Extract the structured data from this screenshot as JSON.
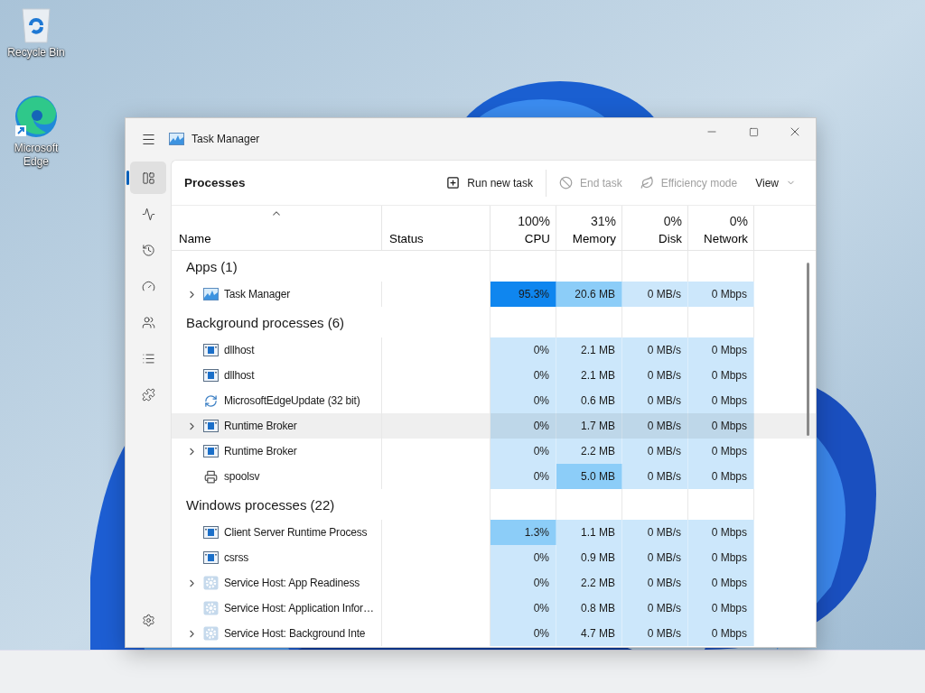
{
  "desktop": {
    "icons": [
      {
        "label": "Recycle Bin",
        "kind": "recycle"
      },
      {
        "label": "Microsoft Edge",
        "kind": "browser"
      }
    ]
  },
  "window": {
    "title": "Task Manager"
  },
  "sidebar": {
    "items": [
      {
        "selected": true
      },
      {
        "selected": false
      },
      {
        "selected": false
      },
      {
        "selected": false
      },
      {
        "selected": false
      },
      {
        "selected": false
      },
      {
        "selected": false
      }
    ]
  },
  "toolbar": {
    "title": "Processes",
    "buttons": [
      {
        "label": "Run new task",
        "kind": "run",
        "disabled": false
      },
      {
        "label": "End task",
        "kind": "end",
        "disabled": true
      },
      {
        "label": "Efficiency mode",
        "kind": "efficiency",
        "disabled": true
      },
      {
        "label": "View",
        "kind": "view",
        "disabled": false
      }
    ]
  },
  "table": {
    "columns": [
      {
        "label": "Name",
        "sorted": true
      },
      {
        "label": "Status",
        "sorted": false
      },
      {
        "label": "CPU",
        "total": "100%",
        "sorted": false
      },
      {
        "label": "Memory",
        "total": "31%",
        "sorted": false
      },
      {
        "label": "Disk",
        "total": "0%",
        "sorted": false
      },
      {
        "label": "Network",
        "total": "0%",
        "sorted": false
      }
    ],
    "groups": [
      {
        "title": "Apps (1)",
        "rows": [
          {
            "name": "Task Manager",
            "kind": "app",
            "expandable": true,
            "hovered": false,
            "cells": [
              {
                "text": "95.3%",
                "kind": "high"
              },
              {
                "text": "20.6 MB",
                "kind": "medium"
              },
              {
                "text": "0 MB/s",
                "kind": "low"
              },
              {
                "text": "0 Mbps",
                "kind": "low"
              }
            ]
          }
        ]
      },
      {
        "title": "Background processes (6)",
        "rows": [
          {
            "name": "dllhost",
            "kind": "process",
            "expandable": false,
            "hovered": false,
            "cells": [
              {
                "text": "0%",
                "kind": "low"
              },
              {
                "text": "2.1 MB",
                "kind": "low"
              },
              {
                "text": "0 MB/s",
                "kind": "low"
              },
              {
                "text": "0 Mbps",
                "kind": "low"
              }
            ]
          },
          {
            "name": "dllhost",
            "kind": "process",
            "expandable": false,
            "hovered": false,
            "cells": [
              {
                "text": "0%",
                "kind": "low"
              },
              {
                "text": "2.1 MB",
                "kind": "low"
              },
              {
                "text": "0 MB/s",
                "kind": "low"
              },
              {
                "text": "0 Mbps",
                "kind": "low"
              }
            ]
          },
          {
            "name": "MicrosoftEdgeUpdate (32 bit)",
            "kind": "updater",
            "expandable": false,
            "hovered": false,
            "cells": [
              {
                "text": "0%",
                "kind": "low"
              },
              {
                "text": "0.6 MB",
                "kind": "low"
              },
              {
                "text": "0 MB/s",
                "kind": "low"
              },
              {
                "text": "0 Mbps",
                "kind": "low"
              }
            ]
          },
          {
            "name": "Runtime Broker",
            "kind": "process",
            "expandable": true,
            "hovered": true,
            "cells": [
              {
                "text": "0%",
                "kind": "low"
              },
              {
                "text": "1.7 MB",
                "kind": "low"
              },
              {
                "text": "0 MB/s",
                "kind": "low"
              },
              {
                "text": "0 Mbps",
                "kind": "low"
              }
            ]
          },
          {
            "name": "Runtime Broker",
            "kind": "process",
            "expandable": true,
            "hovered": false,
            "cells": [
              {
                "text": "0%",
                "kind": "low"
              },
              {
                "text": "2.2 MB",
                "kind": "low"
              },
              {
                "text": "0 MB/s",
                "kind": "low"
              },
              {
                "text": "0 Mbps",
                "kind": "low"
              }
            ]
          },
          {
            "name": "spoolsv",
            "kind": "printer",
            "expandable": false,
            "hovered": false,
            "cells": [
              {
                "text": "0%",
                "kind": "low"
              },
              {
                "text": "5.0 MB",
                "kind": "medium"
              },
              {
                "text": "0 MB/s",
                "kind": "low"
              },
              {
                "text": "0 Mbps",
                "kind": "low"
              }
            ]
          }
        ]
      },
      {
        "title": "Windows processes (22)",
        "rows": [
          {
            "name": "Client Server Runtime Process",
            "kind": "process",
            "expandable": false,
            "hovered": false,
            "cells": [
              {
                "text": "1.3%",
                "kind": "medium"
              },
              {
                "text": "1.1 MB",
                "kind": "low"
              },
              {
                "text": "0 MB/s",
                "kind": "low"
              },
              {
                "text": "0 Mbps",
                "kind": "low"
              }
            ]
          },
          {
            "name": "csrss",
            "kind": "process",
            "expandable": false,
            "hovered": false,
            "cells": [
              {
                "text": "0%",
                "kind": "low"
              },
              {
                "text": "0.9 MB",
                "kind": "low"
              },
              {
                "text": "0 MB/s",
                "kind": "low"
              },
              {
                "text": "0 Mbps",
                "kind": "low"
              }
            ]
          },
          {
            "name": "Service Host: App Readiness",
            "kind": "service",
            "expandable": true,
            "hovered": false,
            "cells": [
              {
                "text": "0%",
                "kind": "low"
              },
              {
                "text": "2.2 MB",
                "kind": "low"
              },
              {
                "text": "0 MB/s",
                "kind": "low"
              },
              {
                "text": "0 Mbps",
                "kind": "low"
              }
            ]
          },
          {
            "name": "Service Host: Application Infor…",
            "kind": "service",
            "expandable": false,
            "hovered": false,
            "cells": [
              {
                "text": "0%",
                "kind": "low"
              },
              {
                "text": "0.8 MB",
                "kind": "low"
              },
              {
                "text": "0 MB/s",
                "kind": "low"
              },
              {
                "text": "0 Mbps",
                "kind": "low"
              }
            ]
          },
          {
            "name": "Service Host: Background Inte",
            "kind": "service",
            "expandable": true,
            "hovered": false,
            "cells": [
              {
                "text": "0%",
                "kind": "low"
              },
              {
                "text": "4.7 MB",
                "kind": "low"
              },
              {
                "text": "0 MB/s",
                "kind": "low"
              },
              {
                "text": "0 Mbps",
                "kind": "low"
              }
            ]
          }
        ]
      }
    ]
  }
}
